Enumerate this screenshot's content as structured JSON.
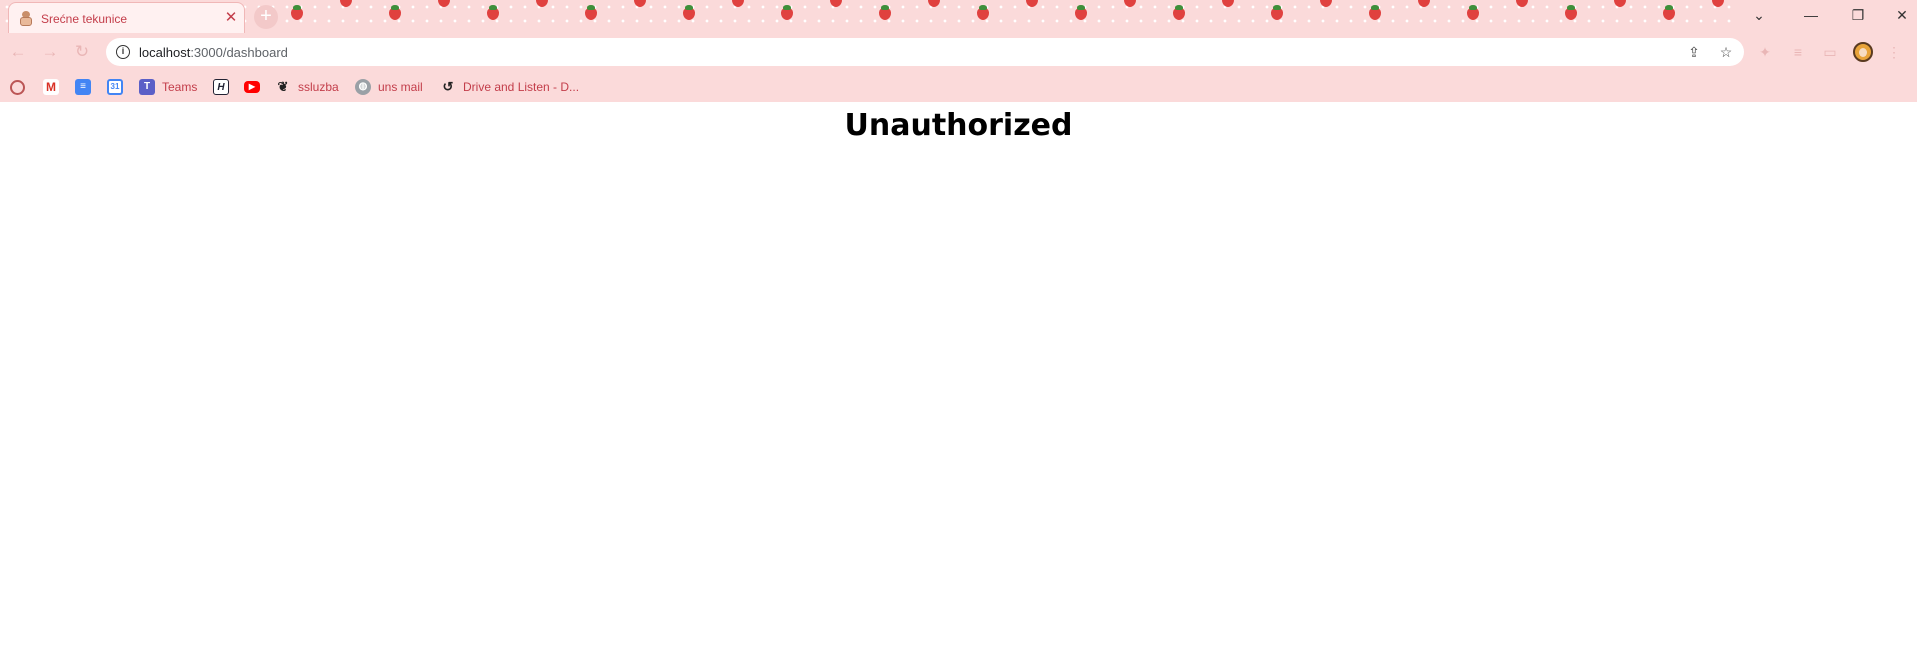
{
  "browser": {
    "tab": {
      "title": "Srećne tekunice",
      "close_glyph": "✕"
    },
    "new_tab_glyph": "+",
    "window_controls": {
      "tabsearch_glyph": "⌄",
      "minimize_glyph": "—",
      "restore_glyph": "❐",
      "close_glyph": "✕"
    },
    "nav": {
      "back_glyph": "←",
      "forward_glyph": "→",
      "reload_glyph": "↻"
    },
    "address": {
      "host": "localhost",
      "path": ":3000/dashboard"
    },
    "omnibox_icons": {
      "share": "⇪",
      "bookmark_star": "☆"
    },
    "menu_glyph": "⋮",
    "bookmarks": [
      {
        "icon": "circle-icon",
        "label": ""
      },
      {
        "icon": "gmail-icon",
        "label": ""
      },
      {
        "icon": "docs-icon",
        "label": ""
      },
      {
        "icon": "calendar-icon",
        "label": ""
      },
      {
        "icon": "teams-icon",
        "label": "Teams"
      },
      {
        "icon": "h-logo-icon",
        "label": ""
      },
      {
        "icon": "youtube-icon",
        "label": ""
      },
      {
        "icon": "ssluzba-icon",
        "label": "ssluzba"
      },
      {
        "icon": "globe-icon",
        "label": "uns mail"
      },
      {
        "icon": "drive-listen-icon",
        "label": "Drive and Listen - D..."
      }
    ]
  },
  "page": {
    "heading": "Unauthorized"
  },
  "colors": {
    "chrome_bg": "#fbdada",
    "accent_text": "#c33d4a",
    "strawberry": "#e0413f"
  }
}
